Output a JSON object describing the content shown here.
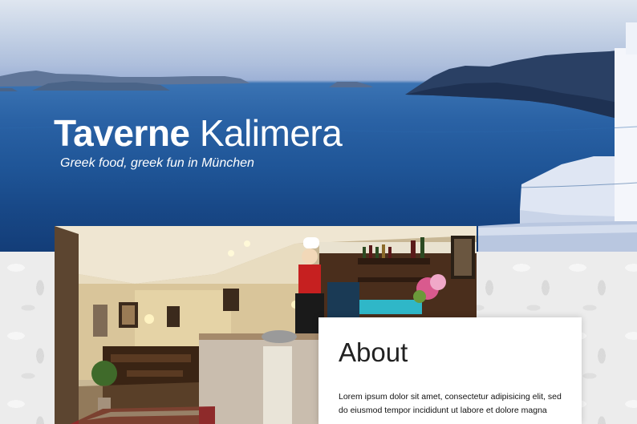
{
  "hero": {
    "title_bold": "Taverne",
    "title_light": "Kalimera",
    "subtitle": "Greek food, greek fun in München"
  },
  "about": {
    "heading": "About",
    "body": "Lorem ipsum dolor sit amet, consectetur adipisicing elit, sed do eiusmod tempor incididunt ut labore et dolore magna"
  },
  "colors": {
    "sea": "#1f5597",
    "sky": "#c6d3e6",
    "card": "#ffffff",
    "pattern": "#ececec"
  },
  "images": {
    "hero": "santorini-sea-view",
    "restaurant": "restaurant-interior-photo"
  }
}
